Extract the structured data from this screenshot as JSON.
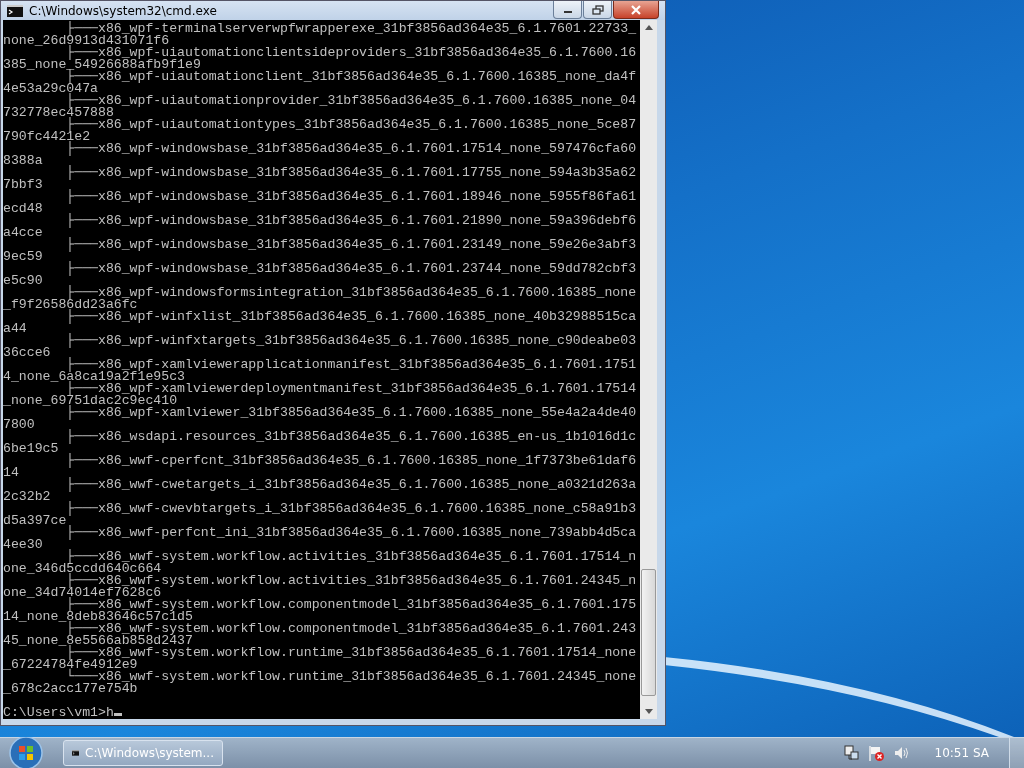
{
  "window": {
    "title": "C:\\Windows\\system32\\cmd.exe"
  },
  "console": {
    "lines": [
      "        ├───x86_wpf-terminalserverwpfwrapperexe_31bf3856ad364e35_6.1.7601.22733_none_26d9913d431071f6",
      "        ├───x86_wpf-uiautomationclientsideproviders_31bf3856ad364e35_6.1.7600.16385_none_54926688afb9f1e9",
      "        ├───x86_wpf-uiautomationclient_31bf3856ad364e35_6.1.7600.16385_none_da4f4e53a29c047a",
      "        ├───x86_wpf-uiautomationprovider_31bf3856ad364e35_6.1.7600.16385_none_04732778ec457888",
      "        ├───x86_wpf-uiautomationtypes_31bf3856ad364e35_6.1.7600.16385_none_5ce87790fc4421e2",
      "        ├───x86_wpf-windowsbase_31bf3856ad364e35_6.1.7601.17514_none_597476cfa608388a",
      "        ├───x86_wpf-windowsbase_31bf3856ad364e35_6.1.7601.17755_none_594a3b35a627bbf3",
      "        ├───x86_wpf-windowsbase_31bf3856ad364e35_6.1.7601.18946_none_5955f86fa61ecd48",
      "        ├───x86_wpf-windowsbase_31bf3856ad364e35_6.1.7601.21890_none_59a396debf6a4cce",
      "        ├───x86_wpf-windowsbase_31bf3856ad364e35_6.1.7601.23149_none_59e26e3abf39ec59",
      "        ├───x86_wpf-windowsbase_31bf3856ad364e35_6.1.7601.23744_none_59dd782cbf3e5c90",
      "        ├───x86_wpf-windowsformsintegration_31bf3856ad364e35_6.1.7600.16385_none_f9f26586dd23a6fc",
      "        ├───x86_wpf-winfxlist_31bf3856ad364e35_6.1.7600.16385_none_40b32988515caa44",
      "        ├───x86_wpf-winfxtargets_31bf3856ad364e35_6.1.7600.16385_none_c90deabe0336cce6",
      "        ├───x86_wpf-xamlviewerapplicationmanifest_31bf3856ad364e35_6.1.7601.17514_none_6a8ca19a2f1e95c3",
      "        ├───x86_wpf-xamlviewerdeploymentmanifest_31bf3856ad364e35_6.1.7601.17514_none_69751dac2c9ec410",
      "        ├───x86_wpf-xamlviewer_31bf3856ad364e35_6.1.7600.16385_none_55e4a2a4de407800",
      "        ├───x86_wsdapi.resources_31bf3856ad364e35_6.1.7600.16385_en-us_1b1016d1c6be19c5",
      "        ├───x86_wwf-cperfcnt_31bf3856ad364e35_6.1.7600.16385_none_1f7373be61daf614",
      "        ├───x86_wwf-cwetargets_i_31bf3856ad364e35_6.1.7600.16385_none_a0321d263a2c32b2",
      "        ├───x86_wwf-cwevbtargets_i_31bf3856ad364e35_6.1.7600.16385_none_c58a91b3d5a397ce",
      "        ├───x86_wwf-perfcnt_ini_31bf3856ad364e35_6.1.7600.16385_none_739abb4d5ca4ee30",
      "        ├───x86_wwf-system.workflow.activities_31bf3856ad364e35_6.1.7601.17514_none_346d5ccdd640c664",
      "        ├───x86_wwf-system.workflow.activities_31bf3856ad364e35_6.1.7601.24345_none_34d74014ef7628c6",
      "        ├───x86_wwf-system.workflow.componentmodel_31bf3856ad364e35_6.1.7601.17514_none_8deb83646c57c1d5",
      "        ├───x86_wwf-system.workflow.componentmodel_31bf3856ad364e35_6.1.7601.24345_none_8e5566ab858d2437",
      "        ├───x86_wwf-system.workflow.runtime_31bf3856ad364e35_6.1.7601.17514_none_67224784fe4912e9",
      "        └───x86_wwf-system.workflow.runtime_31bf3856ad364e35_6.1.7601.24345_none_678c2acc177e754b"
    ],
    "prompt": "C:\\Users\\vm1>h"
  },
  "taskbar": {
    "task": {
      "label": "C:\\Windows\\system..."
    },
    "clock": "10:51 SA"
  }
}
